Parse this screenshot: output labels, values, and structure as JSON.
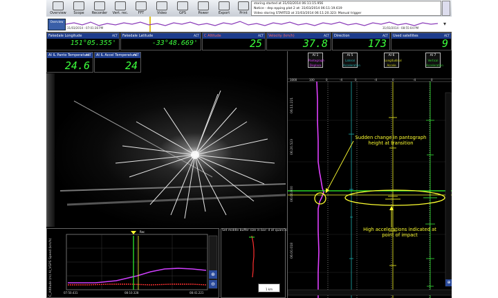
{
  "toolbar": {
    "buttons": [
      {
        "label": "Overview",
        "icon": "overview-icon"
      },
      {
        "label": "Scope",
        "icon": "scope-icon"
      },
      {
        "label": "Recorder",
        "icon": "recorder-icon"
      },
      {
        "label": "Vert. rec.",
        "icon": "vertical-recorder-icon"
      },
      {
        "label": "FFT",
        "icon": "fft-icon"
      },
      {
        "label": "Video",
        "icon": "video-icon"
      },
      {
        "label": "GPS",
        "icon": "gps-icon"
      },
      {
        "label": "Power",
        "icon": "power-icon"
      },
      {
        "label": "Export",
        "icon": "export-icon"
      },
      {
        "label": "Print",
        "icon": "print-icon"
      }
    ],
    "log_lines": [
      "storing started at 31/03/2014 06:11:15.956",
      "Notice - dep epping plat 2 at: 31/03/2014 06:11:19.619",
      "Video storing STARTED at 31/03/2014 06:11:20.323: Manual trigger"
    ]
  },
  "overview": {
    "button_label": "Overview",
    "left_time": "31/03/2014 - 07:01:36 PM",
    "right_time": "31/03/2014 - 08:55:04 PM"
  },
  "readouts": [
    {
      "title": "Fakedale Longitude",
      "value": "151°05.355'"
    },
    {
      "title": "Fakedale Latitude",
      "value": "-33°48.669'"
    },
    {
      "title": "C Altitude",
      "value": "25"
    },
    {
      "title": "Velocity (km/h)",
      "value": "37.8"
    },
    {
      "title": "Direction",
      "value": "173"
    },
    {
      "title": "Used satellites",
      "value": "9"
    }
  ],
  "temps": [
    {
      "title": "AI IL Panto Temperature",
      "value": "24.6"
    },
    {
      "title": "AI IL Accel Temperature",
      "value": "24"
    }
  ],
  "act_label": "ACT",
  "channels": [
    {
      "id": "AI 1",
      "label": "Pantograph Displace",
      "color": "#e040ff"
    },
    {
      "id": "AI 5",
      "label": "Lateral Acceleration",
      "color": "#20b0b0"
    },
    {
      "id": "AI 6",
      "label": "Longitudinal Accele",
      "color": "#d8d820"
    },
    {
      "id": "AI 7",
      "label": "Vertical Acceleration",
      "color": "#30d030"
    }
  ],
  "strip_ticks": {
    "top": [
      "1000",
      "100",
      "0",
      "-4",
      "0",
      "-4",
      "0",
      "-4",
      "0"
    ],
    "times": [
      "06:11:221",
      "06:20.523",
      "06:00.000",
      "06:00.018"
    ]
  },
  "annotations": {
    "top": "Sudden change in pantograph height at transition",
    "bottom": "High accelerations indicated at point of impact"
  },
  "bottom_chart": {
    "y_label": "C_Altitude (m)  AI_VGPS Speed (km/h)",
    "x_ticks": [
      "07:50.431",
      "08:10.328",
      "08:41.221"
    ],
    "marker": "Rec"
  },
  "mid_panel": {
    "title": "Set middle buffer size in bar: d at quan/10000 datapoints",
    "scale_label": "1 km"
  },
  "colors": {
    "display_green": "#3cff3c",
    "panel_blue": "#1d3c8c",
    "annotation_yellow": "#ffff30",
    "overview_purple": "#8a3ab9"
  }
}
